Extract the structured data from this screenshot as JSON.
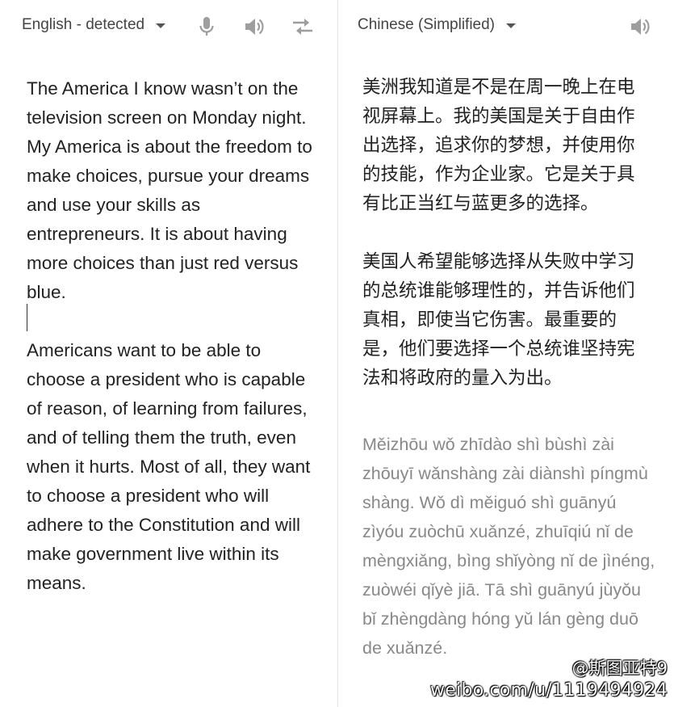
{
  "source": {
    "language_label": "English - detected",
    "paragraphs": [
      "The America I know wasn’t on the television screen on Monday night. My America is about the freedom to make choices, pursue your dreams and use your skills as entrepreneurs. It is about having more choices than just red versus blue.",
      "Americans want to be able to choose a president who is capable of reason, of learning from failures, and of telling them the truth, even when it hurts. Most of all, they want to choose a president who will adhere to the Constitution and will make government live within its means."
    ],
    "icons": {
      "language_dropdown": "chevron-down-icon",
      "voice_input": "microphone-icon",
      "listen": "speaker-icon",
      "swap": "swap-icon"
    }
  },
  "target": {
    "language_label": "Chinese (Simplified)",
    "paragraphs": [
      "美洲我知道是不是在周一晚上在电视屏幕上。我的美国是关于自由作出选择，追求你的梦想，并使用你的技能，作为企业家。它是关于具有比正当红与蓝更多的选择。",
      "美国人希望能够选择从失败中学习的总统谁能够理性的，并告诉他们真相，即使当它伤害。最重要的是，他们要选择一个总统谁坚持宪法和将政府的量入为出。"
    ],
    "pinyin": "Měizhōu wǒ zhīdào shì bùshì zài zhōuyī wǎnshàng zài diànshì píngmù shàng. Wǒ dì měiguó shì guānyú zìyóu zuòchū xuǎnzé, zhuīqiú nǐ de mèngxiǎng, bìng shǐyòng nǐ de jìnéng, zuòwéi qǐyè jiā. Tā shì guānyú jùyǒu bǐ zhèngdàng hóng yǔ lán gèng duō de xuǎnzé.",
    "icons": {
      "language_dropdown": "chevron-down-icon",
      "listen": "speaker-icon"
    }
  },
  "watermark": {
    "handle": "@斯图亚特9",
    "url": "weibo.com/u/1119494924"
  },
  "colors": {
    "text": "#222222",
    "pinyin": "#888888",
    "icon": "#9e9e9e",
    "divider": "#e4e4e4"
  }
}
